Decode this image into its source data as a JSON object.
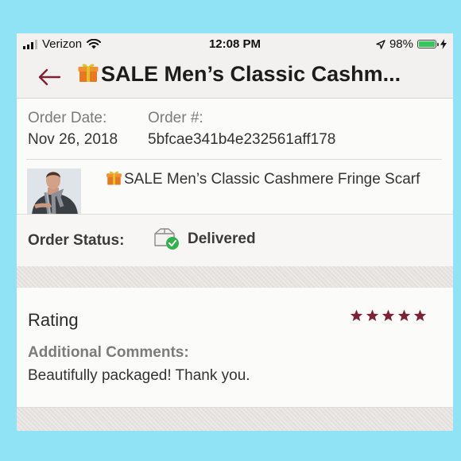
{
  "status_bar": {
    "carrier": "Verizon",
    "time": "12:08 PM",
    "battery": "98%",
    "battery_level": 0.98
  },
  "nav": {
    "title": "SALE Men’s Classic Cashm..."
  },
  "order": {
    "date_label": "Order Date:",
    "date_value": "Nov 26, 2018",
    "number_label": "Order #:",
    "number_value": "5bfcae341b4e232561aff178"
  },
  "item": {
    "title": "SALE Men’s Classic Cashmere Fringe Scarf"
  },
  "status": {
    "label": "Order Status:",
    "value": "Delivered"
  },
  "rating": {
    "label": "Rating",
    "stars": 5,
    "star_color": "#7e2233",
    "comments_label": "Additional Comments:",
    "comments_value": "Beautifully packaged! Thank you."
  },
  "colors": {
    "accent": "#7e2233",
    "delivered_check": "#2fb34a",
    "background": "#8fe3f5"
  }
}
